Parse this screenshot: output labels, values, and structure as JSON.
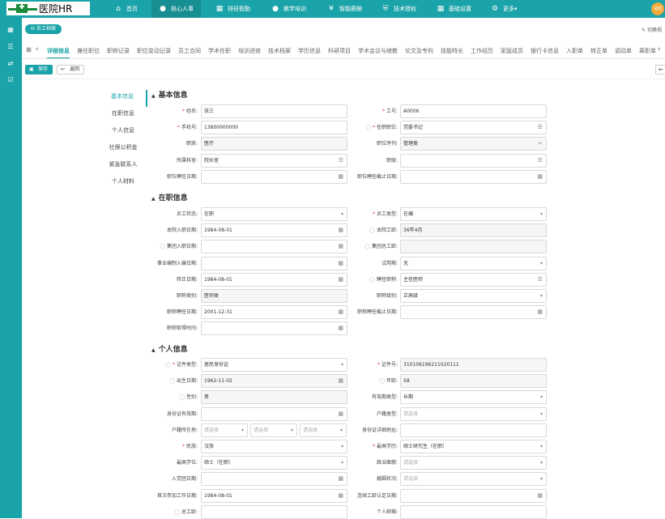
{
  "brand": {
    "name": "医院HR"
  },
  "topnav": [
    {
      "label": "首页",
      "icon": "⌂",
      "active": false
    },
    {
      "label": "核心人事",
      "icon": "👤",
      "active": true
    },
    {
      "label": "排班假勤",
      "icon": "▦",
      "active": false
    },
    {
      "label": "教学培训",
      "icon": "👥",
      "active": false
    },
    {
      "label": "智能薪酬",
      "icon": "¥",
      "active": false
    },
    {
      "label": "技术授权",
      "icon": "⛨",
      "active": false
    },
    {
      "label": "基础设置",
      "icon": "⚙",
      "active": false
    },
    {
      "label": "更多▾",
      "icon": "⚙",
      "active": false
    }
  ],
  "user": {
    "avatar": "请选"
  },
  "breadcrumb": "员工档案",
  "switch_label": "切换视",
  "tabs": [
    "详细信息",
    "兼任职位",
    "职称记录",
    "职位变动记录",
    "员工合同",
    "学术任职",
    "培训进修",
    "技术档案",
    "学历信息",
    "科研项目",
    "学术会议与继教",
    "论文及专利",
    "技能特长",
    "工作经历",
    "家庭成员",
    "银行卡信息",
    "入职单",
    "转正单",
    "调动单",
    "离职单"
  ],
  "actions": {
    "save": "保存",
    "back": "返回"
  },
  "leftnav": [
    "基本信息",
    "在职信息",
    "个人信息",
    "社保公积金",
    "紧急联系人",
    "个人材料"
  ],
  "sections": {
    "basic": "基本信息",
    "job": "在职信息",
    "personal": "个人信息"
  },
  "basic": [
    {
      "label": "姓名:",
      "value": "张三",
      "req": true
    },
    {
      "label": "工号:",
      "value": "A0006",
      "req": true
    },
    {
      "label": "手机号:",
      "value": "13800000000",
      "req": true
    },
    {
      "label": "任职职位:",
      "value": "党委书记",
      "req": true,
      "help": true
    },
    {
      "label": "职族:",
      "value": "医疗"
    },
    {
      "label": "职位序列:",
      "value": "管理类"
    },
    {
      "label": "所属科室:",
      "value": "院长室"
    },
    {
      "label": "职级:",
      "value": ""
    },
    {
      "label": "职位聘任日期:",
      "value": ""
    },
    {
      "label": "职位聘任截止日期:",
      "value": ""
    }
  ],
  "job": [
    {
      "label": "员工状态:",
      "value": "在职"
    },
    {
      "label": "员工类型:",
      "value": "在编",
      "req": true
    },
    {
      "label": "本院入职日期:",
      "value": "1984-08-01"
    },
    {
      "label": "本院工龄:",
      "value": "36年4月",
      "help": true
    },
    {
      "label": "集团入职日期:",
      "value": "",
      "help": true
    },
    {
      "label": "集团总工龄:",
      "value": "",
      "help": true
    },
    {
      "label": "事业编制入编日期:",
      "value": ""
    },
    {
      "label": "试用期:",
      "value": "无"
    },
    {
      "label": "转正日期:",
      "value": "1984-08-01"
    },
    {
      "label": "聘任职称:",
      "value": "主任医师",
      "help": true
    },
    {
      "label": "职称类别:",
      "value": "医师类"
    },
    {
      "label": "职称级别:",
      "value": "正高级"
    },
    {
      "label": "职称聘任日期:",
      "value": "2001-12-31"
    },
    {
      "label": "职称聘任截止日期:",
      "value": ""
    },
    {
      "label": "职称取得时间:",
      "value": ""
    }
  ],
  "personal": [
    {
      "label": "证件类型:",
      "value": "居民身份证",
      "req": true,
      "help": true
    },
    {
      "label": "证件号:",
      "value": "310106196211020111",
      "req": true
    },
    {
      "label": "出生日期:",
      "value": "1962-11-02",
      "help": true
    },
    {
      "label": "年龄:",
      "value": "58",
      "help": true
    },
    {
      "label": "性别:",
      "value": "男",
      "help": true
    },
    {
      "label": "有效期类型:",
      "value": "长期"
    },
    {
      "label": "身份证有效期:",
      "value": ""
    },
    {
      "label": "户籍类型:",
      "value": "请选择"
    },
    {
      "label": "户籍所在地:",
      "value": "请选择"
    },
    {
      "label": "身份证详细地址:",
      "value": ""
    },
    {
      "label": "民族:",
      "value": "汉族",
      "req": true
    },
    {
      "label": "最高学历:",
      "value": "硕士研究生（在职）",
      "req": true
    },
    {
      "label": "最高学位:",
      "value": "硕士（在职）"
    },
    {
      "label": "政治面貌:",
      "value": "请选择"
    },
    {
      "label": "入党团日期:",
      "value": ""
    },
    {
      "label": "婚姻状况:",
      "value": "请选择"
    },
    {
      "label": "首次参加工作日期:",
      "value": "1984-08-01"
    },
    {
      "label": "连续工龄认定日期:",
      "value": ""
    },
    {
      "label": "总工龄:",
      "value": "",
      "help": true
    },
    {
      "label": "个人邮箱:",
      "value": ""
    }
  ],
  "household_selects": [
    "请选择",
    "请选择",
    "请选择"
  ],
  "colors": {
    "brand": "#1aa3a8",
    "required": "#ee3333"
  }
}
